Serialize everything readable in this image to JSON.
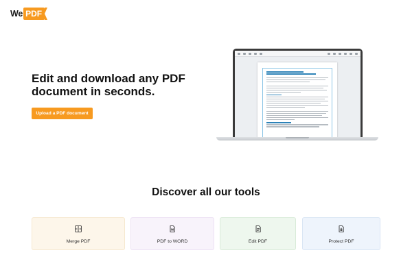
{
  "header": {
    "logo_we": "We",
    "logo_pdf": "PDF"
  },
  "hero": {
    "title": "Edit and download any PDF document in seconds.",
    "cta_label": "Upload a PDF document"
  },
  "tools": {
    "title": "Discover all our tools",
    "cards": [
      {
        "label": "Merge PDF",
        "icon": "merge-icon"
      },
      {
        "label": "PDF to WORD",
        "icon": "word-file-icon"
      },
      {
        "label": "Edit PDF",
        "icon": "edit-file-icon"
      },
      {
        "label": "Protect PDF",
        "icon": "lock-file-icon"
      }
    ]
  },
  "colors": {
    "brand": "#f79a20",
    "doc_accent": "#2d82b7"
  }
}
